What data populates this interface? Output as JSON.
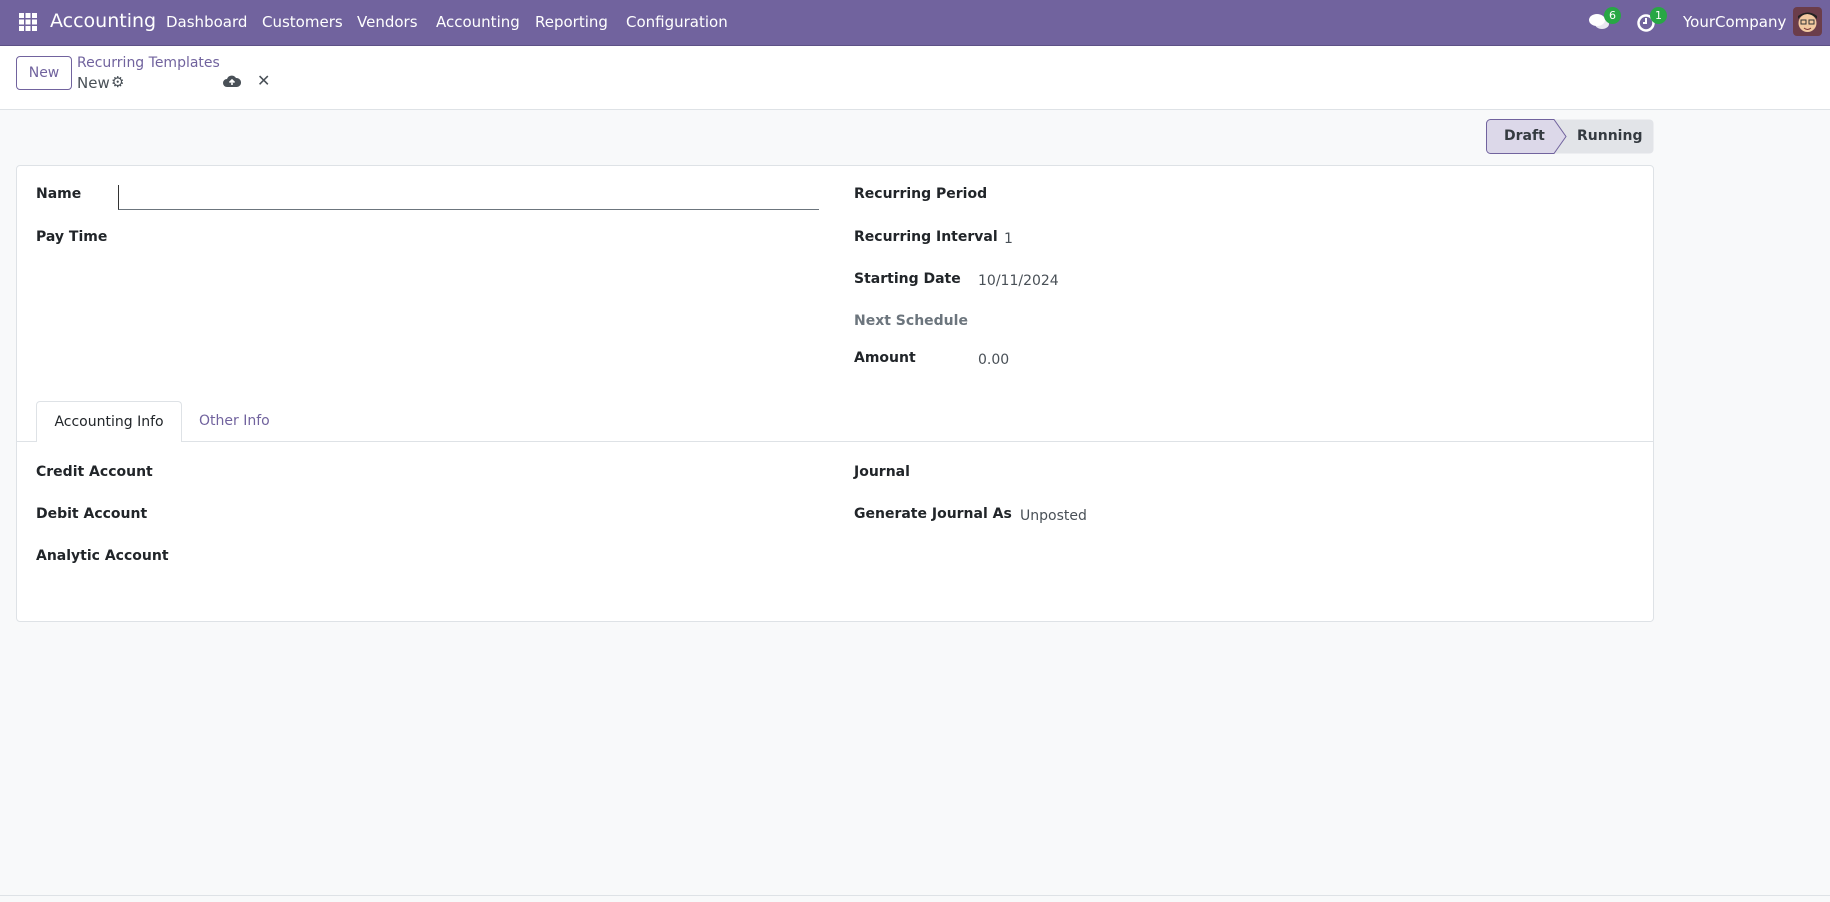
{
  "navbar": {
    "app_title": "Accounting",
    "menu": [
      "Dashboard",
      "Customers",
      "Vendors",
      "Accounting",
      "Reporting",
      "Configuration"
    ],
    "messages_count": "6",
    "activities_count": "1",
    "company": "YourCompany",
    "accent_color": "#71639e"
  },
  "control_panel": {
    "new_label": "New",
    "breadcrumb_parent": "Recurring Templates",
    "breadcrumb_current": "New"
  },
  "statusbar": {
    "stages": [
      "Draft",
      "Running"
    ],
    "active": "Draft"
  },
  "form": {
    "left": {
      "name_label": "Name",
      "name_value": "",
      "pay_time_label": "Pay Time"
    },
    "right": {
      "recurring_period_label": "Recurring Period",
      "recurring_interval_label": "Recurring Interval",
      "recurring_interval_value": "1",
      "starting_date_label": "Starting Date",
      "starting_date_value": "10/11/2024",
      "next_schedule_label": "Next Schedule",
      "amount_label": "Amount",
      "amount_value": "0.00"
    },
    "tabs": [
      "Accounting Info",
      "Other Info"
    ],
    "accounting_info": {
      "credit_account_label": "Credit Account",
      "debit_account_label": "Debit Account",
      "analytic_account_label": "Analytic Account",
      "journal_label": "Journal",
      "generate_journal_as_label": "Generate Journal As",
      "generate_journal_as_value": "Unposted"
    }
  }
}
